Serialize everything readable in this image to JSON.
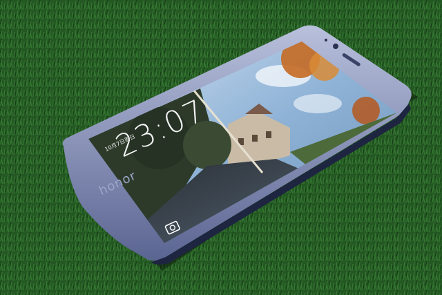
{
  "scene": {
    "lockscreen_time": "23:07",
    "lockscreen_date": "10月7日周日",
    "brand": "honor",
    "colors": {
      "grass": "#2b6a2a",
      "phone_body": "#2c3550",
      "bezel": "#9aa3c4",
      "screen_sky": "#8fb3d7"
    },
    "icons": [
      "camera-icon",
      "front-camera-icon",
      "earpiece-icon"
    ]
  }
}
